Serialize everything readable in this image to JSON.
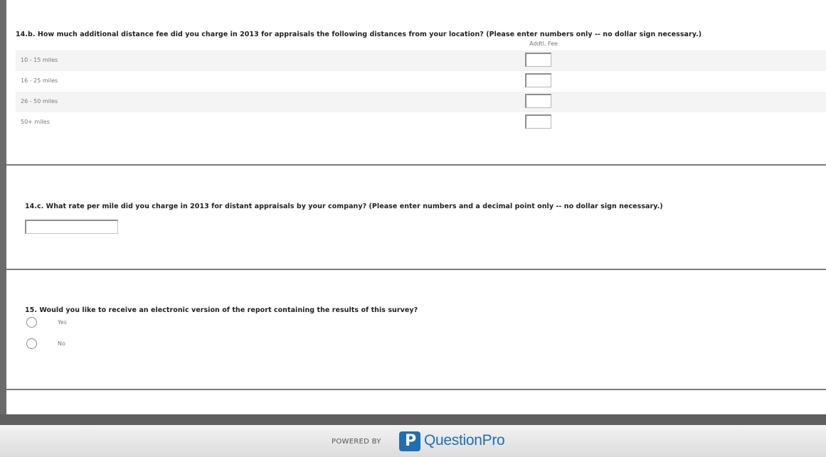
{
  "q14b": {
    "title": "14.b. How much additional distance fee did you charge in 2013 for appraisals the following distances from your location? (Please enter numbers only -- no dollar sign necessary.)",
    "column_header": "Addtl. Fee",
    "rows": [
      {
        "label": "10 - 15 miles",
        "value": ""
      },
      {
        "label": "16 - 25 miles",
        "value": ""
      },
      {
        "label": "26 - 50 miles",
        "value": ""
      },
      {
        "label": "50+ miles",
        "value": ""
      }
    ]
  },
  "q14c": {
    "title": "14.c. What rate per mile did you charge in 2013 for distant appraisals by your company? (Please enter numbers and a decimal point only -- no dollar sign necessary.)",
    "value": ""
  },
  "q15": {
    "title": "15. Would you like to receive an electronic version of the report containing the results of this survey?",
    "options": [
      {
        "label": "Yes",
        "selected": false
      },
      {
        "label": "No",
        "selected": false
      }
    ]
  },
  "footer": {
    "powered_by": "POWERED BY",
    "brand_name": "QuestionPro",
    "logo_letter": "P",
    "brand_color": "#1f6fb4"
  }
}
